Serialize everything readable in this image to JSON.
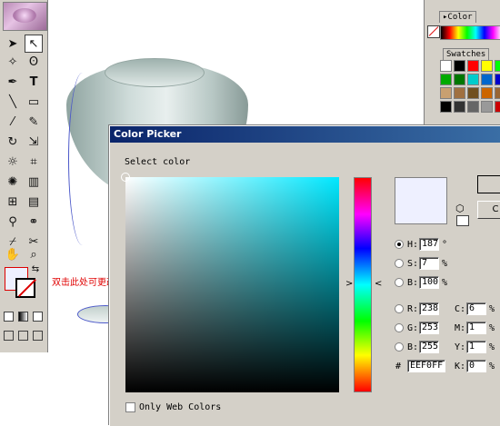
{
  "toolbox": {
    "tools": [
      "selection-tool",
      "direct-selection-tool",
      "magic-wand-tool",
      "lasso-tool",
      "pen-tool",
      "type-tool",
      "line-tool",
      "rectangle-tool",
      "paintbrush-tool",
      "pencil-tool",
      "rotate-tool",
      "scale-tool",
      "warp-tool",
      "free-transform-tool",
      "symbol-sprayer-tool",
      "column-graph-tool",
      "mesh-tool",
      "gradient-tool",
      "eyedropper-tool",
      "blend-tool",
      "slice-tool",
      "scissors-tool",
      "hand-tool",
      "zoom-tool"
    ]
  },
  "canvas": {
    "annotation": "双击此处可更改表面颜色"
  },
  "right_panel": {
    "color_tab": "Color",
    "swatches_tab": "Swatches",
    "swatch_colors": [
      "#ffffff",
      "#000000",
      "#ff0000",
      "#ffff00",
      "#00ff00",
      "#00aa00",
      "#007700",
      "#00cccc",
      "#0066cc",
      "#0000cc",
      "#c8a070",
      "#a07040",
      "#705020",
      "#cc6600",
      "#996633",
      "#000000",
      "#333333",
      "#666666",
      "#999999",
      "#cc0000"
    ]
  },
  "dialog": {
    "title": "Color Picker",
    "select_color_label": "Select color",
    "ok_label": "",
    "cancel_label": "C",
    "selected_color": "#eef0ff",
    "hsb": [
      {
        "label": "H:",
        "value": "187",
        "unit": "°",
        "selected": true
      },
      {
        "label": "S:",
        "value": "7",
        "unit": "%",
        "selected": false
      },
      {
        "label": "B:",
        "value": "100",
        "unit": "%",
        "selected": false
      }
    ],
    "rgb": [
      {
        "label": "R:",
        "value": "238"
      },
      {
        "label": "G:",
        "value": "253"
      },
      {
        "label": "B:",
        "value": "255"
      }
    ],
    "cmyk": [
      {
        "label": "C:",
        "value": "6",
        "unit": "%"
      },
      {
        "label": "M:",
        "value": "1",
        "unit": "%"
      },
      {
        "label": "Y:",
        "value": "1",
        "unit": "%"
      },
      {
        "label": "K:",
        "value": "0",
        "unit": "%"
      }
    ],
    "hex_label": "#",
    "hex_value": "EEF0FF",
    "only_web_colors_label": "Only Web Colors"
  }
}
